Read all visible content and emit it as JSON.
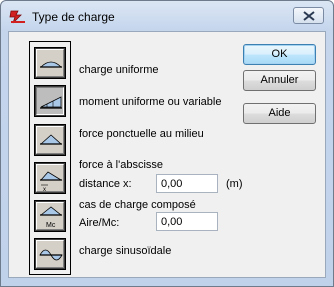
{
  "window": {
    "title": "Type de charge"
  },
  "colors": {
    "button_fill": "#a9c7e6",
    "accent": "#3c7fb1",
    "icon_red": "#d21f1f"
  },
  "icons": {
    "app": "red-beam-load-icon",
    "close": "close-x-icon",
    "loads": [
      "uniform-load-icon",
      "variable-moment-icon",
      "midspan-point-load-icon",
      "offset-point-load-icon",
      "composite-load-icon",
      "sinusoidal-load-icon"
    ]
  },
  "options": {
    "uniform": "charge uniforme",
    "moment": "moment uniforme ou variable",
    "point_mid": "force ponctuelle au milieu",
    "point_abscissa": "force à l'abscisse",
    "composite": "cas de charge composé",
    "sinusoidal": "charge sinusoïdale"
  },
  "fields": {
    "distance": {
      "label": "distance x:",
      "value": "0,00",
      "unit": "(m)"
    },
    "area": {
      "label": "Aire/Mc:",
      "value": "0,00"
    }
  },
  "buttons": {
    "ok": "OK",
    "cancel": "Annuler",
    "help": "Aide"
  },
  "selected_option": "moment",
  "composite_icon_label": "Mc"
}
